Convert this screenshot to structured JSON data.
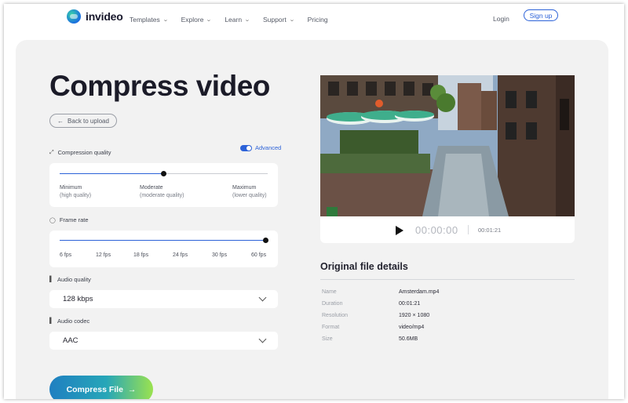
{
  "nav": {
    "logo_text": "invideo",
    "menu": [
      {
        "label": "Templates",
        "has_dropdown": true
      },
      {
        "label": "Explore",
        "has_dropdown": true
      },
      {
        "label": "Learn",
        "has_dropdown": true
      },
      {
        "label": "Support",
        "has_dropdown": true
      },
      {
        "label": "Pricing",
        "has_dropdown": false
      }
    ],
    "login_label": "Login",
    "signup_label": "Sign up"
  },
  "page": {
    "title": "Compress video",
    "back_label": "Back to upload"
  },
  "compression": {
    "label": "Compression quality",
    "advanced_label": "Advanced",
    "advanced_on": true,
    "value_fraction": 0.5,
    "options": [
      {
        "label": "Minimum",
        "sub": "(high quality)"
      },
      {
        "label": "Moderate",
        "sub": "(moderate quality)"
      },
      {
        "label": "Maximum",
        "sub": "(lower quality)"
      }
    ]
  },
  "frame_rate": {
    "label": "Frame rate",
    "value": "60 fps",
    "value_fraction": 1.0,
    "ticks": [
      "6 fps",
      "12 fps",
      "18 fps",
      "24 fps",
      "30 fps",
      "60 fps"
    ]
  },
  "audio_quality": {
    "label": "Audio quality",
    "value": "128 kbps"
  },
  "audio_codec": {
    "label": "Audio codec",
    "value": "AAC"
  },
  "compress_button": {
    "label": "Compress File",
    "arrow": "→"
  },
  "player": {
    "current_time": "00:00:00",
    "duration": "00:01:21"
  },
  "details": {
    "title": "Original file details",
    "rows": [
      {
        "key": "Name",
        "value": "Amsterdam.mp4"
      },
      {
        "key": "Duration",
        "value": "00:01:21"
      },
      {
        "key": "Resolution",
        "value": "1920 × 1080"
      },
      {
        "key": "Format",
        "value": "video/mp4"
      },
      {
        "key": "Size",
        "value": "50.6MB"
      }
    ]
  },
  "colors": {
    "accent": "#2c62d8",
    "panel_bg": "#f2f2f2",
    "button_gradient_start": "#1f7fc1",
    "button_gradient_end": "#9be24f"
  }
}
